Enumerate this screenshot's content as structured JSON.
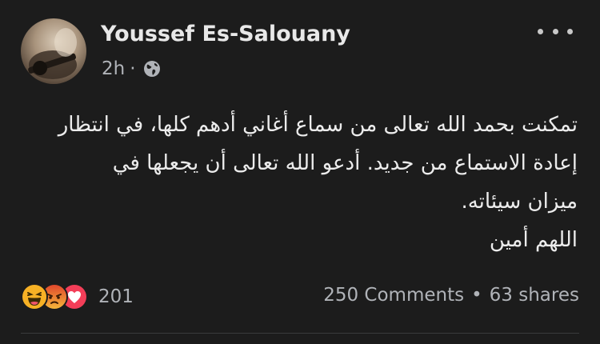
{
  "post": {
    "author": "Youssef Es-Salouany",
    "time": "2h",
    "separator": "·",
    "audience_icon": "globe-icon",
    "more_icon": "more-options-icon",
    "text_lines": [
      "تمكنت بحمد الله تعالى من سماع أغاني أدهم كلها، في انتظار",
      "إعادة الاستماع من جديد. أدعو الله تعالى أن يجعلها في",
      "ميزان سيئاته.",
      "اللهم أمين"
    ],
    "reactions": {
      "icons": [
        "haha-icon",
        "angry-icon",
        "love-icon"
      ],
      "count": "201"
    },
    "comments": "250 Comments",
    "dot": "•",
    "shares": "63 shares"
  },
  "colors": {
    "background": "#1c1c1c",
    "primary_text": "#e4e6eb",
    "secondary_text": "#b0b3b8",
    "love": "#f33e58",
    "haha": "#f7b125",
    "angry": "#e9710f"
  }
}
